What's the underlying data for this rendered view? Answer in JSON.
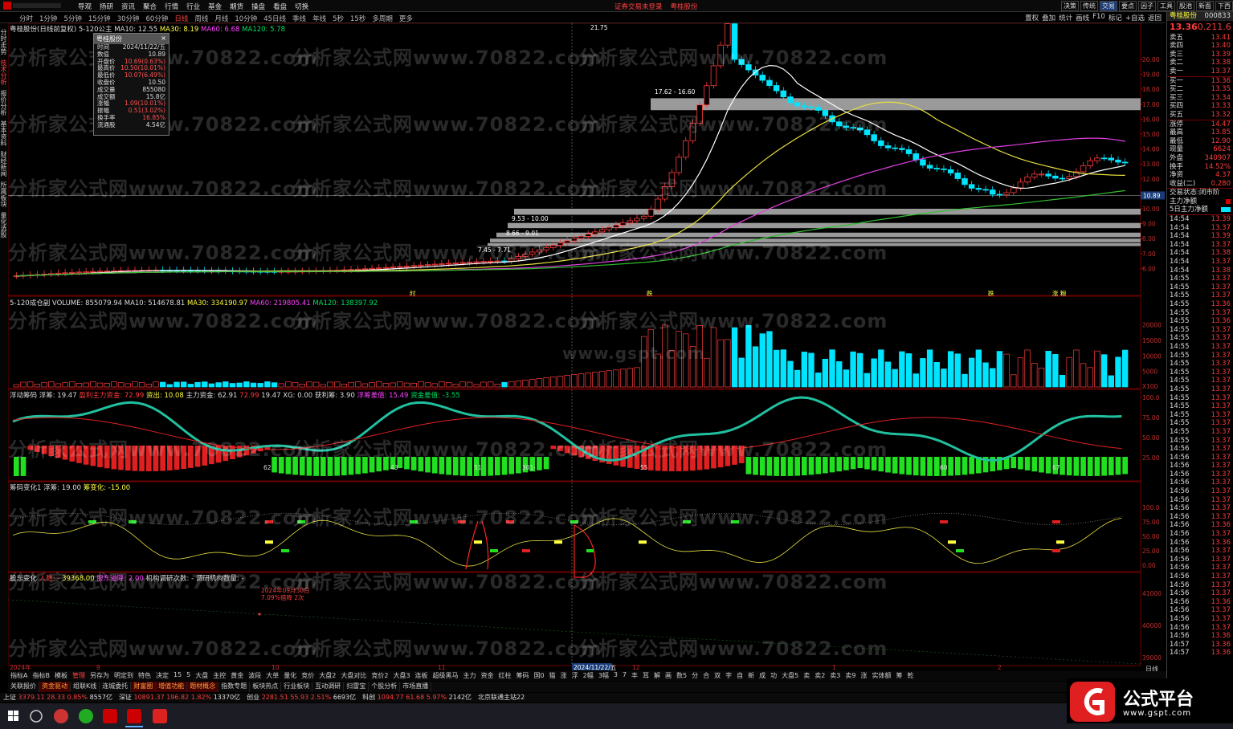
{
  "menu": [
    "导观",
    "扬研",
    "资讯",
    "聚合",
    "行情",
    "行业",
    "基金",
    "期货",
    "操盘",
    "看盘",
    "切换"
  ],
  "title_center": [
    "证券交易未登录",
    "粤桂股份"
  ],
  "toolbar_right": [
    "决策",
    "传统",
    "交易",
    "要点",
    "因子",
    "工具",
    "股池",
    "新面",
    "下西"
  ],
  "periods": [
    "分时",
    "1分钟",
    "5分钟",
    "15分钟",
    "30分钟",
    "60分钟",
    "日线",
    "周线",
    "月线",
    "10分钟",
    "45日线",
    "季线",
    "年线",
    "5秒",
    "15秒",
    "多周期",
    "更多"
  ],
  "selected_period": "日线",
  "tools": [
    "置权",
    "叠加",
    "统计",
    "画线",
    "F10",
    "标记",
    "+自选",
    "返回"
  ],
  "left_tabs": [
    "分时走势",
    "技术分析",
    "报价分析",
    "基本资料",
    "财经新闻",
    "所属板块",
    "量化选股"
  ],
  "main_title": {
    "stock": "粤桂股份(日线前复权)",
    "indicator": "5-120公主",
    "ma10": "MA10: 12.55",
    "ma30": "MA30: 8.19",
    "ma60": "MA60: 6.68",
    "ma120": "MA120: 5.78"
  },
  "infobox": {
    "title": "粤桂股份",
    "rows": [
      [
        "时间",
        "2024/11/22/五"
      ],
      [
        "数值",
        "10.89"
      ],
      [
        "开盘价",
        "10.69(0.63%)"
      ],
      [
        "最高价",
        "10.50(10.01%)"
      ],
      [
        "最低价",
        "10.07(6.49%)"
      ],
      [
        "收盘价",
        "10.50"
      ],
      [
        "成交量",
        "855080"
      ],
      [
        "成交额",
        "15.8亿"
      ],
      [
        "涨幅",
        "1.09(10.01%)"
      ],
      [
        "振幅",
        "0.51(3.02%)"
      ],
      [
        "换手率",
        "16.85%"
      ],
      [
        "流通股",
        "4.54亿"
      ]
    ]
  },
  "price_labels": [
    "21.75",
    "17.62 - 16.60",
    "9.53 - 10.00",
    "8.66 - 9.01",
    "7.45 - 7.71"
  ],
  "price_axis": [
    "20.00",
    "19.00",
    "18.00",
    "17.00",
    "16.00",
    "15.00",
    "14.00",
    "13.00",
    "12.00",
    "11.00",
    "10.00",
    "9.00",
    "8.00",
    "7.00",
    "6.00"
  ],
  "cursor_price": "10.89",
  "vol_title": {
    "name": "5-120成仓副",
    "volume": "VOLUME: 855079.94",
    "ma10": "MA10: 514678.81",
    "ma30": "MA30: 334190.97",
    "ma60": "MA60: 219805.41",
    "ma120": "MA120: 138397.92"
  },
  "vol_axis": [
    "20000",
    "15000",
    "10000",
    "5000",
    "X100"
  ],
  "float_title": {
    "name": "浮动筹码",
    "a": "浮筹: 19.47",
    "b": "盈利主力资金: 72.99",
    "c": "资出: 10.08",
    "d": "主力资金: 62.91",
    "e": "72.99",
    "f": "19.47",
    "g": "XG: 0.00",
    "h": "获利筹: 3.90",
    "i": "浮筹差值: 15.49",
    "j": "资金差值: -3.55"
  },
  "float_axis": [
    "100.0",
    "75.00",
    "50.00",
    "25.00"
  ],
  "float_numbers": [
    "62",
    "43",
    "51",
    "301-",
    "55",
    "60",
    "67"
  ],
  "chip_title": {
    "name": "筹码变化1",
    "a": "浮筹: 19.00",
    "b": "筹变化: -15.00"
  },
  "chip_axis": [
    "100.0",
    "75.00",
    "50.00",
    "25.00",
    "0.00"
  ],
  "holder_title": {
    "name": "股东变化",
    "a": "人数: -",
    "b": "39368.00",
    "c": "股东道降: 2.00",
    "d": "机构调研次数: -",
    "e": "调研机构数量: -"
  },
  "holder_axis": [
    "41000",
    "40000",
    "39000"
  ],
  "holder_note": [
    "2024年09月30日",
    "7.09%借降 2次"
  ],
  "date_axis": [
    "2024年",
    "9",
    "10",
    "11",
    "2024/11/22/五",
    "12",
    "1",
    "2"
  ],
  "markers": [
    "时",
    "跌",
    "跌",
    "涨 粮"
  ],
  "watermark": [
    "分析家公式网www.70822.com",
    "分析家公式网www.70822.com",
    "分析家公式网www.70822.com"
  ],
  "watermark2": "www.gspt.com",
  "right_panel": {
    "name": "粤桂股份",
    "code": "000833",
    "price": "13.36",
    "chg": "0.21",
    "pct": "1.6",
    "asks": [
      [
        "卖五",
        "13.41"
      ],
      [
        "卖四",
        "13.40"
      ],
      [
        "卖三",
        "13.39"
      ],
      [
        "卖二",
        "13.38"
      ],
      [
        "卖一",
        "13.37"
      ]
    ],
    "bids": [
      [
        "买一",
        "13.36"
      ],
      [
        "买二",
        "13.35"
      ],
      [
        "买三",
        "13.34"
      ],
      [
        "买四",
        "13.33"
      ],
      [
        "买五",
        "13.32"
      ]
    ],
    "stats": [
      [
        "涨停",
        "14.47"
      ],
      [
        "最高",
        "13.85"
      ],
      [
        "最低",
        "12.90"
      ],
      [
        "现量",
        "6624"
      ],
      [
        "外盘",
        "340907"
      ],
      [
        "换手",
        "14.52%"
      ],
      [
        "净资",
        "4.37"
      ],
      [
        "收益(二)",
        "0.280"
      ]
    ],
    "status": "交易状态:闭市阶",
    "flow1": "主力净额",
    "flow2": "5日主力净额",
    "ticks": [
      [
        "14:54",
        "13.39"
      ],
      [
        "14:54",
        "13.37"
      ],
      [
        "14:54",
        "13.39"
      ],
      [
        "14:54",
        "13.37"
      ],
      [
        "14:54",
        "13.38"
      ],
      [
        "14:54",
        "13.37"
      ],
      [
        "14:54",
        "13.38"
      ],
      [
        "14:55",
        "13.37"
      ],
      [
        "14:55",
        "13.37"
      ],
      [
        "14:55",
        "13.37"
      ],
      [
        "14:55",
        "13.36"
      ],
      [
        "14:55",
        "13.37"
      ],
      [
        "14:55",
        "13.36"
      ],
      [
        "14:55",
        "13.37"
      ],
      [
        "14:55",
        "13.37"
      ],
      [
        "14:55",
        "13.37"
      ],
      [
        "14:55",
        "13.37"
      ],
      [
        "14:55",
        "13.37"
      ],
      [
        "14:55",
        "13.37"
      ],
      [
        "14:55",
        "13.37"
      ],
      [
        "14:55",
        "13.37"
      ],
      [
        "14:55",
        "13.37"
      ],
      [
        "14:55",
        "13.37"
      ],
      [
        "14:55",
        "13.37"
      ],
      [
        "14:55",
        "13.37"
      ],
      [
        "14:55",
        "13.37"
      ],
      [
        "14:55",
        "13.37"
      ],
      [
        "14:56",
        "13.37"
      ],
      [
        "14:56",
        "13.37"
      ],
      [
        "14:56",
        "13.37"
      ],
      [
        "14:56",
        "13.37"
      ],
      [
        "14:56",
        "13.37"
      ],
      [
        "14:56",
        "13.37"
      ],
      [
        "14:56",
        "13.37"
      ],
      [
        "14:56",
        "13.37"
      ],
      [
        "14:56",
        "13.37"
      ],
      [
        "14:56",
        "13.36"
      ],
      [
        "14:56",
        "13.37"
      ],
      [
        "14:56",
        "13.36"
      ],
      [
        "14:56",
        "13.37"
      ],
      [
        "14:56",
        "13.37"
      ],
      [
        "14:56",
        "13.37"
      ],
      [
        "14:56",
        "13.37"
      ],
      [
        "14:56",
        "13.37"
      ],
      [
        "14:56",
        "13.37"
      ],
      [
        "14:56",
        "13.36"
      ],
      [
        "14:56",
        "13.37"
      ],
      [
        "14:56",
        "13.37"
      ],
      [
        "14:56",
        "13.37"
      ],
      [
        "14:56",
        "13.36"
      ],
      [
        "14:57",
        "13.36"
      ],
      [
        "14:57",
        "13.36"
      ]
    ],
    "period": "日线"
  },
  "bottom_tabs1": [
    "指标A",
    "指标B",
    "模板",
    "管理",
    "另存为",
    "明定到",
    "特色",
    "决定",
    "15",
    "5",
    "大盘",
    "主控",
    "黄金",
    "波段",
    "大单",
    "量化",
    "竞价",
    "大盘2",
    "大盘对比",
    "竞价2",
    "大盘3",
    "连板",
    "超级黑马",
    "主力",
    "资金",
    "红柱",
    "筹码",
    "国0",
    "猫",
    "涨",
    "浮",
    "2幅",
    "3幅",
    "3",
    "7",
    "丰",
    "耳",
    "解",
    "画",
    "数5",
    "分",
    "合",
    "双",
    "字",
    "自",
    "新",
    "成",
    "功",
    "大盘5",
    "卖",
    "卖2",
    "卖3",
    "卖9",
    "涨",
    "实体额",
    "筹",
    "乾"
  ],
  "bottom_tabs2": [
    "关联报价",
    "资金驱动",
    "组联K线",
    "连城委托",
    "财富圈",
    "增值功能",
    "题材概念",
    "指数专题",
    "板块热点",
    "行业板块",
    "互动调研",
    "扫雷宝",
    "个股分析",
    "市场直播"
  ],
  "statusbar": [
    [
      "上证",
      "3379.11",
      "28.33",
      "0.85%",
      "8557亿"
    ],
    [
      "深证",
      "10891.37",
      "196.82",
      "1.82%",
      "13370亿"
    ],
    [
      "创业",
      "2281.51",
      "55.93",
      "2.51%",
      "6693亿"
    ],
    [
      "科创",
      "1094.77",
      "61.68",
      "5.97%",
      "2142亿"
    ]
  ],
  "server": "北京联通主站22",
  "logo_text": "公式平台",
  "logo_url": "www.gspt.com",
  "colors": {
    "bull": "#ff3c3c",
    "bear": "#00e5ff",
    "ma1": "#ffffff",
    "ma2": "#e8e040",
    "ma3": "#e040e0",
    "ma4": "#30c030"
  }
}
